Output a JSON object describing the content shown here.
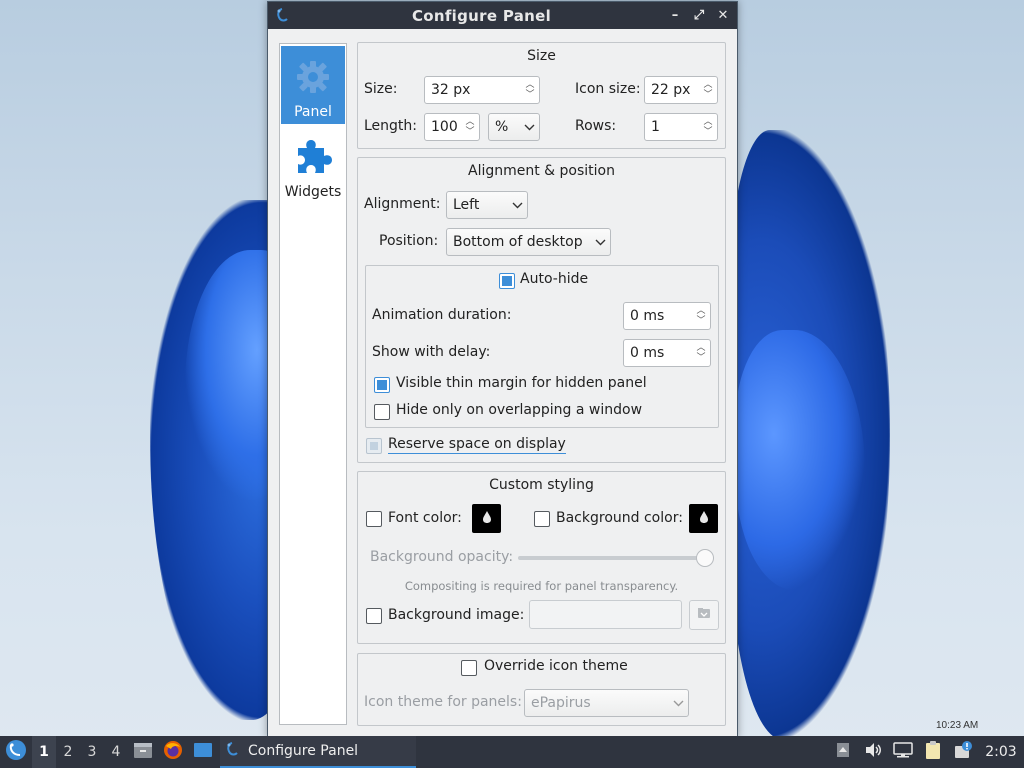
{
  "window": {
    "title": "Configure Panel",
    "controls": {
      "minimize": "–",
      "maximize": "⤢",
      "close": "✕"
    }
  },
  "sidenav": {
    "items": [
      {
        "label": "Panel",
        "icon": "gear-icon",
        "active": true
      },
      {
        "label": "Widgets",
        "icon": "puzzle-icon",
        "active": false
      }
    ]
  },
  "size_group": {
    "title": "Size",
    "size_label": "Size:",
    "size_value": "32 px",
    "icon_size_label": "Icon size:",
    "icon_size_value": "22 px",
    "length_label": "Length:",
    "length_value": "100",
    "length_unit": "%",
    "rows_label": "Rows:",
    "rows_value": "1"
  },
  "alignment_group": {
    "title": "Alignment & position",
    "alignment_label": "Alignment:",
    "alignment_value": "Left",
    "position_label": "Position:",
    "position_value": "Bottom of desktop",
    "autohide": {
      "label": "Auto-hide",
      "checked": true,
      "animation_label": "Animation duration:",
      "animation_value": "0 ms",
      "delay_label": "Show with delay:",
      "delay_value": "0 ms",
      "thin_margin_label": "Visible thin margin for hidden panel",
      "thin_margin_checked": true,
      "overlap_label": "Hide only on overlapping a window",
      "overlap_checked": false
    },
    "reserve_label": "Reserve space on display",
    "reserve_state": "partial"
  },
  "styling_group": {
    "title": "Custom styling",
    "font_color_label": "Font color:",
    "bg_color_label": "Background color:",
    "opacity_label": "Background opacity:",
    "opacity_value": 1.0,
    "compositing_note": "Compositing is required for panel transparency.",
    "bg_image_label": "Background image:",
    "bg_image_value": ""
  },
  "icon_theme_group": {
    "override_label": "Override icon theme",
    "theme_label": "Icon theme for panels:",
    "theme_value": "ePapirus"
  },
  "taskbar": {
    "workspaces": [
      "1",
      "2",
      "3",
      "4"
    ],
    "active_workspace": "1",
    "task_label": "Configure Panel",
    "clock": "2:03"
  },
  "desktop": {
    "clock_overlay": "10:23 AM"
  },
  "colors": {
    "accent": "#3d8ed8",
    "titlebar": "#2f343f",
    "window_bg": "#eff0f1"
  }
}
